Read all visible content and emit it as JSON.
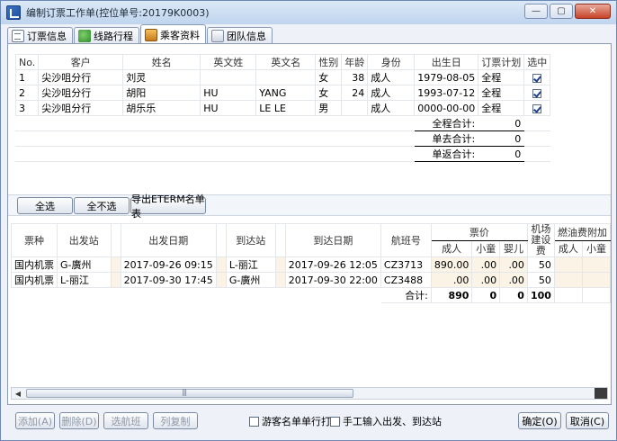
{
  "window": {
    "title": "编制订票工作单(控位单号:20179K0003)",
    "controls": {
      "minimize": "—",
      "maximize": "▢",
      "close": "✕"
    }
  },
  "tabs": [
    {
      "label": "订票信息",
      "icon": "document-icon"
    },
    {
      "label": "线路行程",
      "icon": "route-icon"
    },
    {
      "label": "乘客资料",
      "icon": "passenger-icon",
      "active": true
    },
    {
      "label": "团队信息",
      "icon": "team-icon"
    }
  ],
  "passengers": {
    "headers": [
      "No.",
      "客户",
      "姓名",
      "英文姓",
      "英文名",
      "性别",
      "年龄",
      "身份",
      "出生日",
      "订票计划",
      "选中"
    ],
    "rows": [
      {
        "no": "1",
        "customer": "尖沙咀分行",
        "name": "刘灵",
        "last": "",
        "first": "",
        "gender": "女",
        "age": "38",
        "identity": "成人",
        "birth": "1979-08-05",
        "plan": "全程",
        "selected": true
      },
      {
        "no": "2",
        "customer": "尖沙咀分行",
        "name": "胡阳",
        "last": "HU",
        "first": "YANG",
        "gender": "女",
        "age": "24",
        "identity": "成人",
        "birth": "1993-07-12",
        "plan": "全程",
        "selected": true
      },
      {
        "no": "3",
        "customer": "尖沙咀分行",
        "name": "胡乐乐",
        "last": "HU",
        "first": "LE LE",
        "gender": "男",
        "age": "",
        "identity": "成人",
        "birth": "0000-00-00",
        "plan": "全程",
        "selected": true
      }
    ],
    "totals": [
      {
        "label": "全程合计:",
        "value": "0"
      },
      {
        "label": "单去合计:",
        "value": "0"
      },
      {
        "label": "单返合计:",
        "value": "0"
      }
    ]
  },
  "midbar": {
    "select_all": "全选",
    "select_none": "全不选",
    "export": "导出ETERM名单表"
  },
  "flights": {
    "headers": {
      "type": "票种",
      "from": "出发站",
      "dep_date": "出发日期",
      "to": "到达站",
      "arr_date": "到达日期",
      "flight_no": "航班号",
      "fare": "票价",
      "adult": "成人",
      "child": "小童",
      "infant": "婴儿",
      "airport_fee": "机场建设费",
      "fuel": "燃油费附加",
      "fuel_adult": "成人",
      "fuel_child": "小童"
    },
    "rows": [
      {
        "type": "国内机票",
        "from": "G-廣州",
        "dep_date": "2017-09-26 09:15",
        "to": "L-丽江",
        "arr_date": "2017-09-26 12:05",
        "flight_no": "CZ3713",
        "adult": "890.00",
        "child": ".00",
        "infant": ".00",
        "fee": "50"
      },
      {
        "type": "国内机票",
        "from": "L-丽江",
        "dep_date": "2017-09-30 17:45",
        "to": "G-廣州",
        "arr_date": "2017-09-30 22:00",
        "flight_no": "CZ3488",
        "adult": ".00",
        "child": ".00",
        "infant": ".00",
        "fee": "50"
      }
    ],
    "total": {
      "label": "合计:",
      "adult": "890",
      "child": "0",
      "infant": "0",
      "fee": "100"
    }
  },
  "bottom": {
    "add": "添加(A)",
    "delete": "删除(D)",
    "pick_flight": "选航班",
    "copy_col": "列复制",
    "print_single": "游客名单单行打印",
    "manual_input": "手工输入出发、到达站",
    "ok": "确定(O)",
    "cancel": "取消(C)"
  }
}
